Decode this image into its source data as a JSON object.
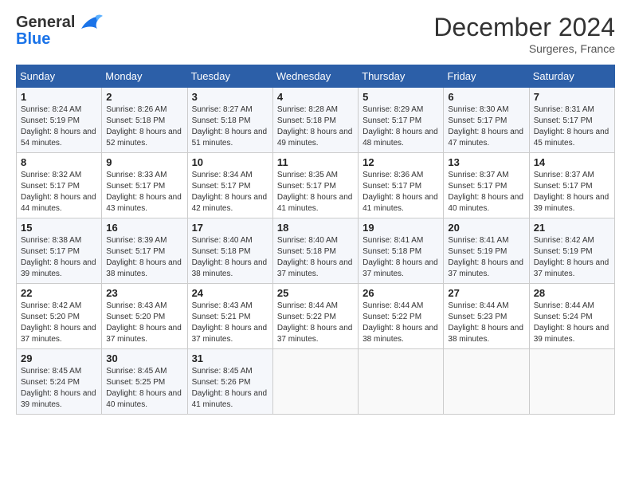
{
  "logo": {
    "line1": "General",
    "line2": "Blue"
  },
  "title": "December 2024",
  "subtitle": "Surgeres, France",
  "days_header": [
    "Sunday",
    "Monday",
    "Tuesday",
    "Wednesday",
    "Thursday",
    "Friday",
    "Saturday"
  ],
  "weeks": [
    [
      {
        "day": "1",
        "sunrise": "8:24 AM",
        "sunset": "5:19 PM",
        "daylight": "8 hours and 54 minutes."
      },
      {
        "day": "2",
        "sunrise": "8:26 AM",
        "sunset": "5:18 PM",
        "daylight": "8 hours and 52 minutes."
      },
      {
        "day": "3",
        "sunrise": "8:27 AM",
        "sunset": "5:18 PM",
        "daylight": "8 hours and 51 minutes."
      },
      {
        "day": "4",
        "sunrise": "8:28 AM",
        "sunset": "5:18 PM",
        "daylight": "8 hours and 49 minutes."
      },
      {
        "day": "5",
        "sunrise": "8:29 AM",
        "sunset": "5:17 PM",
        "daylight": "8 hours and 48 minutes."
      },
      {
        "day": "6",
        "sunrise": "8:30 AM",
        "sunset": "5:17 PM",
        "daylight": "8 hours and 47 minutes."
      },
      {
        "day": "7",
        "sunrise": "8:31 AM",
        "sunset": "5:17 PM",
        "daylight": "8 hours and 45 minutes."
      }
    ],
    [
      {
        "day": "8",
        "sunrise": "8:32 AM",
        "sunset": "5:17 PM",
        "daylight": "8 hours and 44 minutes."
      },
      {
        "day": "9",
        "sunrise": "8:33 AM",
        "sunset": "5:17 PM",
        "daylight": "8 hours and 43 minutes."
      },
      {
        "day": "10",
        "sunrise": "8:34 AM",
        "sunset": "5:17 PM",
        "daylight": "8 hours and 42 minutes."
      },
      {
        "day": "11",
        "sunrise": "8:35 AM",
        "sunset": "5:17 PM",
        "daylight": "8 hours and 41 minutes."
      },
      {
        "day": "12",
        "sunrise": "8:36 AM",
        "sunset": "5:17 PM",
        "daylight": "8 hours and 41 minutes."
      },
      {
        "day": "13",
        "sunrise": "8:37 AM",
        "sunset": "5:17 PM",
        "daylight": "8 hours and 40 minutes."
      },
      {
        "day": "14",
        "sunrise": "8:37 AM",
        "sunset": "5:17 PM",
        "daylight": "8 hours and 39 minutes."
      }
    ],
    [
      {
        "day": "15",
        "sunrise": "8:38 AM",
        "sunset": "5:17 PM",
        "daylight": "8 hours and 39 minutes."
      },
      {
        "day": "16",
        "sunrise": "8:39 AM",
        "sunset": "5:17 PM",
        "daylight": "8 hours and 38 minutes."
      },
      {
        "day": "17",
        "sunrise": "8:40 AM",
        "sunset": "5:18 PM",
        "daylight": "8 hours and 38 minutes."
      },
      {
        "day": "18",
        "sunrise": "8:40 AM",
        "sunset": "5:18 PM",
        "daylight": "8 hours and 37 minutes."
      },
      {
        "day": "19",
        "sunrise": "8:41 AM",
        "sunset": "5:18 PM",
        "daylight": "8 hours and 37 minutes."
      },
      {
        "day": "20",
        "sunrise": "8:41 AM",
        "sunset": "5:19 PM",
        "daylight": "8 hours and 37 minutes."
      },
      {
        "day": "21",
        "sunrise": "8:42 AM",
        "sunset": "5:19 PM",
        "daylight": "8 hours and 37 minutes."
      }
    ],
    [
      {
        "day": "22",
        "sunrise": "8:42 AM",
        "sunset": "5:20 PM",
        "daylight": "8 hours and 37 minutes."
      },
      {
        "day": "23",
        "sunrise": "8:43 AM",
        "sunset": "5:20 PM",
        "daylight": "8 hours and 37 minutes."
      },
      {
        "day": "24",
        "sunrise": "8:43 AM",
        "sunset": "5:21 PM",
        "daylight": "8 hours and 37 minutes."
      },
      {
        "day": "25",
        "sunrise": "8:44 AM",
        "sunset": "5:22 PM",
        "daylight": "8 hours and 37 minutes."
      },
      {
        "day": "26",
        "sunrise": "8:44 AM",
        "sunset": "5:22 PM",
        "daylight": "8 hours and 38 minutes."
      },
      {
        "day": "27",
        "sunrise": "8:44 AM",
        "sunset": "5:23 PM",
        "daylight": "8 hours and 38 minutes."
      },
      {
        "day": "28",
        "sunrise": "8:44 AM",
        "sunset": "5:24 PM",
        "daylight": "8 hours and 39 minutes."
      }
    ],
    [
      {
        "day": "29",
        "sunrise": "8:45 AM",
        "sunset": "5:24 PM",
        "daylight": "8 hours and 39 minutes."
      },
      {
        "day": "30",
        "sunrise": "8:45 AM",
        "sunset": "5:25 PM",
        "daylight": "8 hours and 40 minutes."
      },
      {
        "day": "31",
        "sunrise": "8:45 AM",
        "sunset": "5:26 PM",
        "daylight": "8 hours and 41 minutes."
      },
      null,
      null,
      null,
      null
    ]
  ],
  "labels": {
    "sunrise": "Sunrise:",
    "sunset": "Sunset:",
    "daylight": "Daylight:"
  }
}
